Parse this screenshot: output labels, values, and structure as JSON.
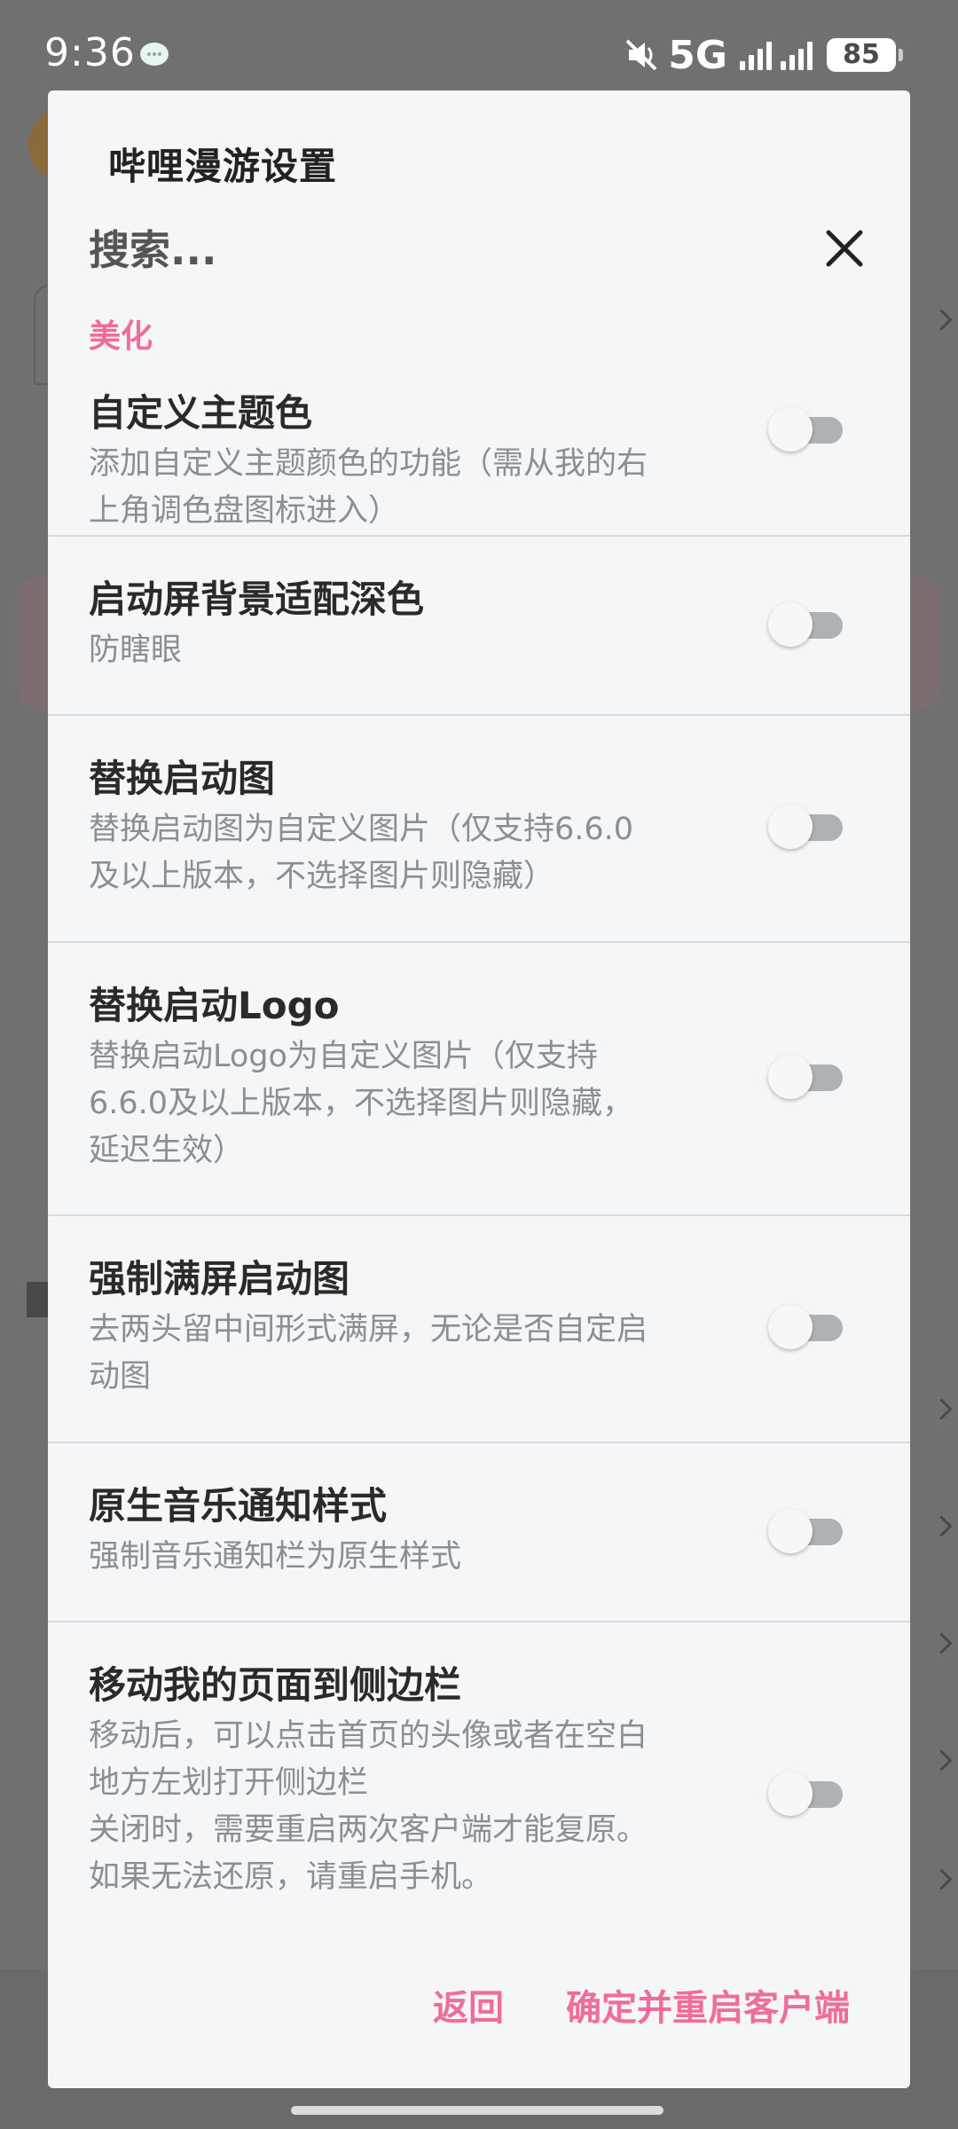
{
  "status_bar": {
    "time": "9:36",
    "network": "5G",
    "battery": "85",
    "icons": [
      "message-bubble-icon",
      "mute-icon",
      "signal-icon",
      "signal-icon"
    ]
  },
  "dialog": {
    "title": "哔哩漫游设置",
    "search_placeholder": "搜索...",
    "section_header": "美化",
    "accent_color": "#ef6c9b",
    "settings": [
      {
        "title": "自定义主题色",
        "desc": "添加自定义主题颜色的功能（需从我的右\n上角调色盘图标进入）",
        "enabled": false
      },
      {
        "title": "启动屏背景适配深色",
        "desc": "防瞎眼",
        "enabled": false
      },
      {
        "title": "替换启动图",
        "desc": "替换启动图为自定义图片（仅支持6.6.0\n及以上版本，不选择图片则隐藏）",
        "enabled": false
      },
      {
        "title": "替换启动Logo",
        "desc": "替换启动Logo为自定义图片（仅支持\n6.6.0及以上版本，不选择图片则隐藏，\n延迟生效）",
        "enabled": false
      },
      {
        "title": "强制满屏启动图",
        "desc": "去两头留中间形式满屏，无论是否自定启\n动图",
        "enabled": false
      },
      {
        "title": "原生音乐通知样式",
        "desc": "强制音乐通知栏为原生样式",
        "enabled": false
      },
      {
        "title": "移动我的页面到侧边栏",
        "desc": "移动后，可以点击首页的头像或者在空白\n地方左划打开侧边栏\n关闭时，需要重启两次客户端才能复原。\n如果无法还原，请重启手机。",
        "enabled": false
      }
    ],
    "actions": {
      "back": "返回",
      "confirm": "确定并重启客户端"
    }
  }
}
